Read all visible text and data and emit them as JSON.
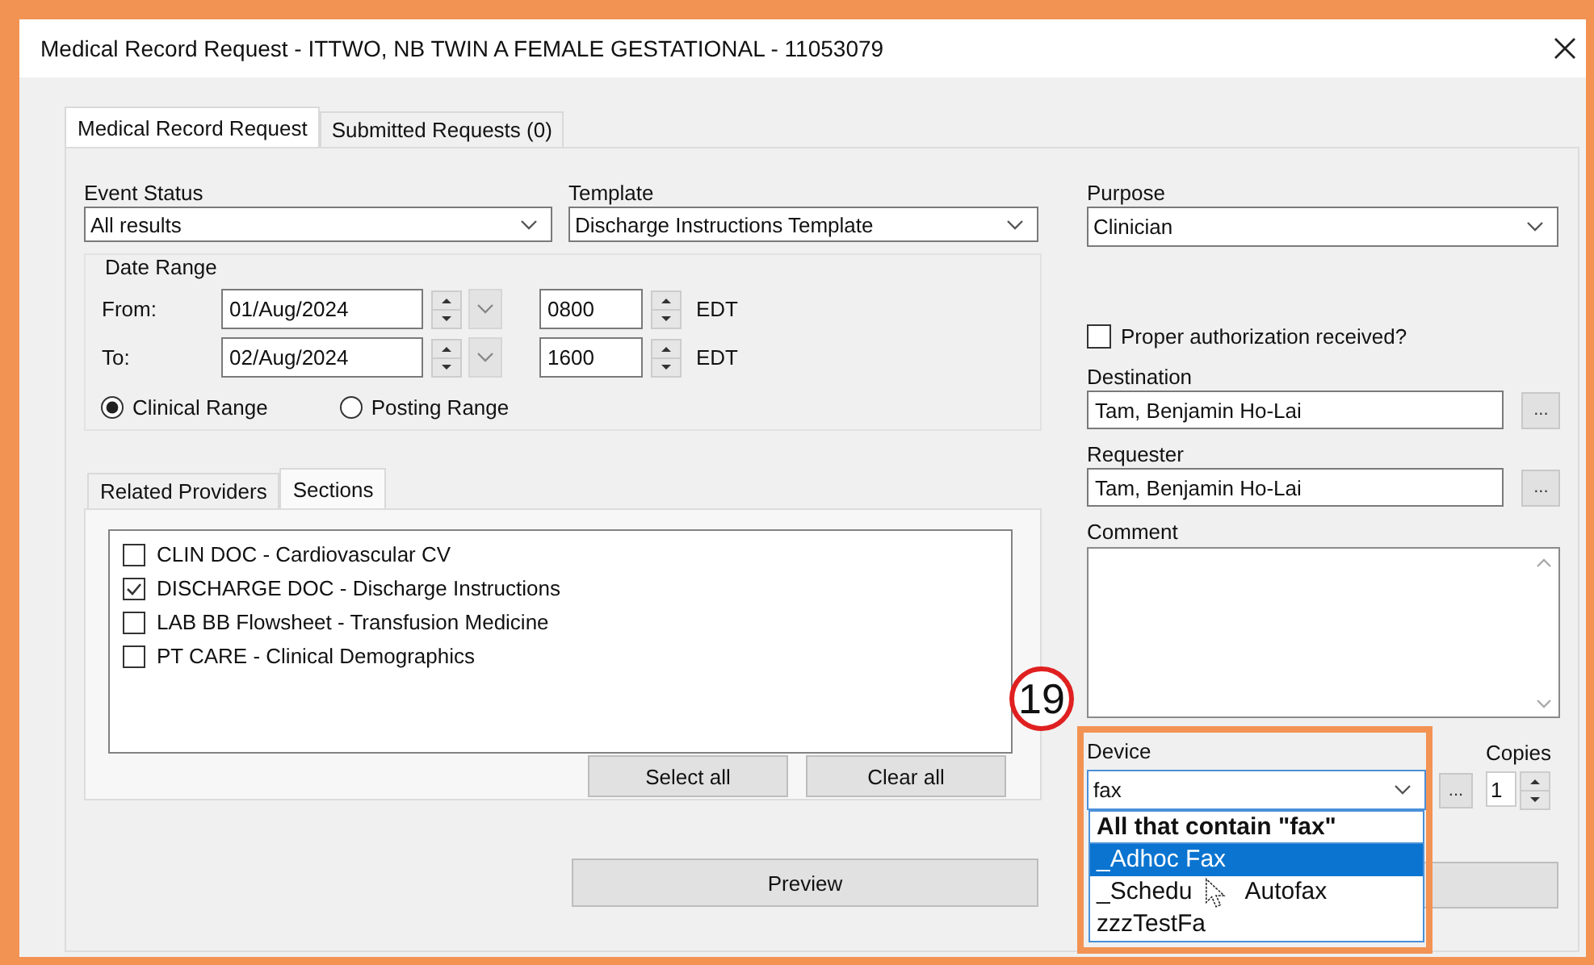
{
  "window": {
    "title": "Medical Record Request - ITTWO, NB TWIN A FEMALE GESTATIONAL - 11053079"
  },
  "tabs": [
    {
      "label": "Medical Record Request",
      "selected": true
    },
    {
      "label": "Submitted Requests (0)",
      "selected": false
    }
  ],
  "event_status": {
    "label": "Event Status",
    "value": "All results"
  },
  "template": {
    "label": "Template",
    "value": "Discharge Instructions Template"
  },
  "date_range": {
    "title": "Date Range",
    "rows": [
      {
        "label": "From:",
        "date": "01/Aug/2024",
        "time": "0800",
        "zone": "EDT"
      },
      {
        "label": "To:",
        "date": "02/Aug/2024",
        "time": "1600",
        "zone": "EDT"
      }
    ],
    "ranges": [
      {
        "label": "Clinical Range",
        "selected": true
      },
      {
        "label": "Posting Range",
        "selected": false
      }
    ]
  },
  "section_tabs": [
    {
      "label": "Related Providers",
      "selected": false
    },
    {
      "label": "Sections",
      "selected": true
    }
  ],
  "sections": [
    {
      "label": "CLIN DOC - Cardiovascular CV",
      "checked": false
    },
    {
      "label": "DISCHARGE DOC - Discharge Instructions",
      "checked": true
    },
    {
      "label": "LAB BB Flowsheet - Transfusion Medicine",
      "checked": false
    },
    {
      "label": "PT CARE - Clinical Demographics",
      "checked": false
    }
  ],
  "select_all": "Select all",
  "clear_all": "Clear all",
  "preview": "Preview",
  "purpose": {
    "label": "Purpose",
    "value": "Clinician"
  },
  "authorization": {
    "label": "Proper authorization received?",
    "checked": false
  },
  "destination": {
    "label": "Destination",
    "value": "Tam, Benjamin Ho-Lai",
    "button": "..."
  },
  "requester": {
    "label": "Requester",
    "value": "Tam, Benjamin Ho-Lai",
    "button": "..."
  },
  "comment": {
    "label": "Comment"
  },
  "device": {
    "label": "Device",
    "value": "fax",
    "button": "..."
  },
  "copies": {
    "label": "Copies",
    "value": "1"
  },
  "dropdown": {
    "header": "All that contain \"fax\"",
    "items": [
      {
        "label": "_Adhoc Fax",
        "selected": true
      },
      {
        "label": "_Schedu        Autofax",
        "selected": false
      },
      {
        "label": "zzzTestFa",
        "selected": false
      }
    ]
  },
  "callout": "19"
}
